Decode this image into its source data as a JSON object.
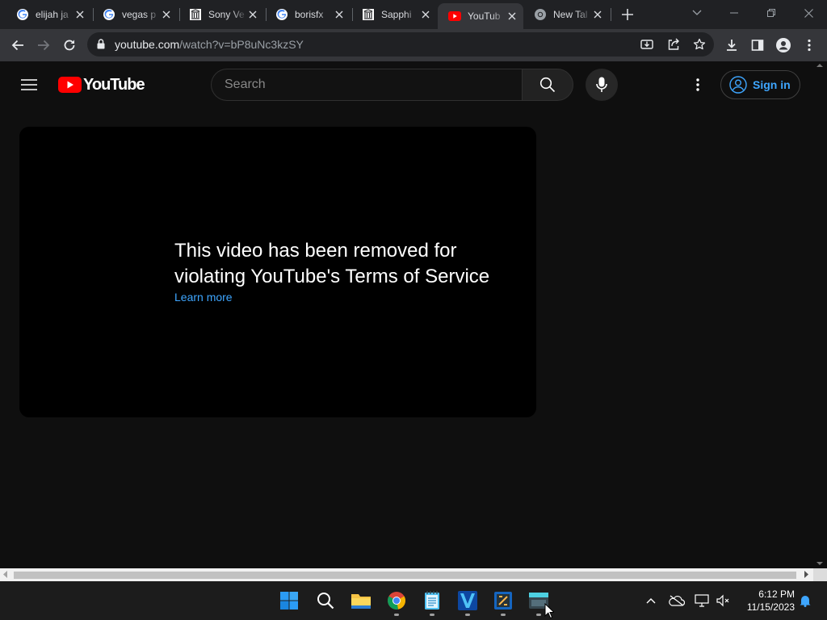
{
  "browser": {
    "tabs": [
      {
        "title": "elijah ja",
        "favicon": "google-g-icon"
      },
      {
        "title": "vegas p",
        "favicon": "google-g-icon"
      },
      {
        "title": "Sony Ve",
        "favicon": "bank-building-icon"
      },
      {
        "title": "borisfx",
        "favicon": "google-g-icon"
      },
      {
        "title": "Sapphi",
        "favicon": "bank-building-icon"
      },
      {
        "title": "YouTub",
        "favicon": "youtube-icon",
        "active": true
      },
      {
        "title": "New Tal",
        "favicon": "chrome-icon"
      }
    ],
    "url_host": "youtube.com",
    "url_path": "/watch?v=bP8uNc3kzSY"
  },
  "youtube": {
    "logo_text": "YouTube",
    "search_placeholder": "Search",
    "signin_label": "Sign in",
    "removed_message": "This video has been removed for violating YouTube's Terms of Service",
    "learn_more": "Learn more"
  },
  "taskbar": {
    "apps": [
      "windows-start-icon",
      "search-icon",
      "file-explorer-icon",
      "chrome-icon",
      "notepad-icon",
      "vegas-pro-icon",
      "tool-app-icon",
      "window-app-icon"
    ],
    "time": "6:12 PM",
    "date": "11/15/2023"
  },
  "colors": {
    "youtube_red": "#ff0000",
    "link_blue": "#3ea6ff",
    "page_bg": "#0f0f0f"
  }
}
